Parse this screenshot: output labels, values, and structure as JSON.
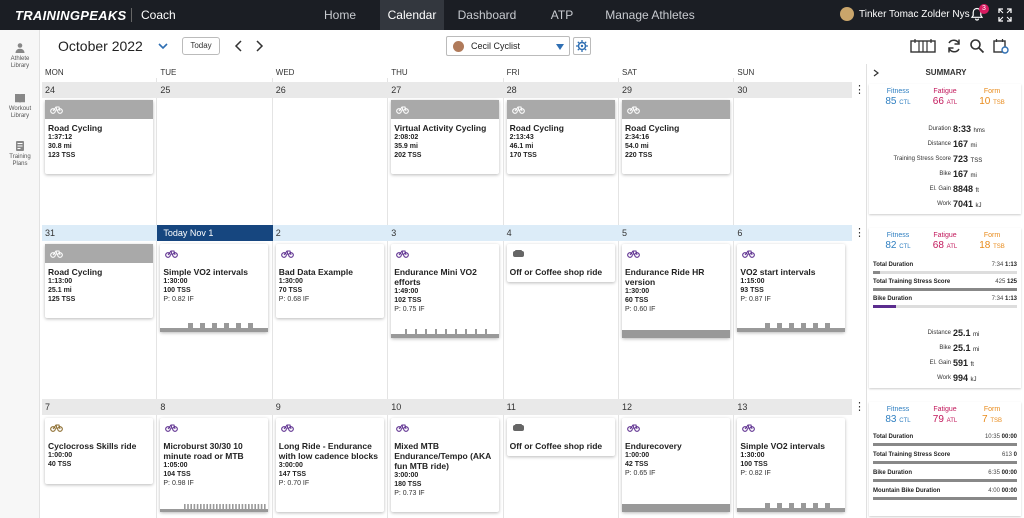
{
  "topbar": {
    "logo": "TRAININGPEAKS",
    "role": "Coach",
    "nav": [
      "Home",
      "Calendar",
      "Dashboard",
      "ATP",
      "Manage Athletes"
    ],
    "active_nav": "Calendar",
    "notification_count": "3",
    "user_name": "Tinker Tomac Zolder Nys"
  },
  "sidebar": [
    {
      "label1": "Athlete",
      "label2": "Library"
    },
    {
      "label1": "Workout",
      "label2": "Library"
    },
    {
      "label1": "Training",
      "label2": "Plans"
    }
  ],
  "toolbar": {
    "month": "October 2022",
    "today_label": "Today",
    "athlete": "Cecil Cyclist"
  },
  "days": [
    "MON",
    "TUE",
    "WED",
    "THU",
    "FRI",
    "SAT",
    "SUN"
  ],
  "weeks": [
    {
      "dates": [
        "24",
        "25",
        "26",
        "27",
        "28",
        "29",
        "30"
      ],
      "today_index": -1,
      "cards": [
        {
          "col": 0,
          "type": "bike-gray",
          "title": "Road Cycling",
          "lines": [
            "1:37:12",
            "30.8 mi",
            "123 TSS"
          ]
        },
        {
          "col": 3,
          "type": "bike-gray",
          "title": "Virtual Activity Cycling",
          "lines": [
            "2:08:02",
            "35.9 mi",
            "202 TSS"
          ]
        },
        {
          "col": 4,
          "type": "bike-gray",
          "title": "Road Cycling",
          "lines": [
            "2:13:43",
            "46.1 mi",
            "170 TSS"
          ]
        },
        {
          "col": 5,
          "type": "bike-gray",
          "title": "Road Cycling",
          "lines": [
            "2:34:16",
            "54.0 mi",
            "220 TSS"
          ]
        }
      ]
    },
    {
      "dates": [
        "31",
        "Today Nov 1",
        "2",
        "3",
        "4",
        "5",
        "6"
      ],
      "today_index": 1,
      "cards": [
        {
          "col": 0,
          "type": "bike-gray",
          "title": "Road Cycling",
          "lines": [
            "1:13:00",
            "25.1 mi",
            "125 TSS"
          ]
        },
        {
          "col": 1,
          "type": "bike",
          "title": "Simple VO2 intervals",
          "lines": [
            "1:30:00",
            "100 TSS"
          ],
          "if": "P: 0.82 IF",
          "spark": "intervals"
        },
        {
          "col": 2,
          "type": "bike",
          "title": "Bad Data Example",
          "lines": [
            "1:30:00",
            "70 TSS"
          ],
          "if": "P: 0.68 IF"
        },
        {
          "col": 3,
          "type": "bike",
          "title": "Endurance Mini VO2 efforts",
          "lines": [
            "1:49:00",
            "102 TSS"
          ],
          "if": "P: 0.75 IF",
          "spark": "spikes"
        },
        {
          "col": 4,
          "type": "other",
          "title": "Off or Coffee shop ride",
          "lines": []
        },
        {
          "col": 5,
          "type": "bike",
          "title": "Endurance Ride HR version",
          "lines": [
            "1:30:00",
            "60 TSS"
          ],
          "if": "P: 0.60 IF",
          "spark": "flat"
        },
        {
          "col": 6,
          "type": "bike",
          "title": "VO2 start intervals",
          "lines": [
            "1:15:00",
            "93 TSS"
          ],
          "if": "P: 0.87 IF",
          "spark": "intervals"
        }
      ]
    },
    {
      "dates": [
        "7",
        "8",
        "9",
        "10",
        "11",
        "12",
        "13"
      ],
      "today_index": -1,
      "cards": [
        {
          "col": 0,
          "type": "mtb",
          "title": "Cyclocross Skills ride",
          "lines": [
            "1:00:00",
            "40 TSS"
          ]
        },
        {
          "col": 1,
          "type": "bike",
          "title": "Microburst 30/30 10 minute road or MTB",
          "lines": [
            "1:05:00",
            "104 TSS"
          ],
          "if": "P: 0.98 IF",
          "spark": "dense"
        },
        {
          "col": 2,
          "type": "bike",
          "title": "Long Ride - Endurance with low cadence blocks",
          "lines": [
            "3:00:00",
            "147 TSS"
          ],
          "if": "P: 0.70 IF"
        },
        {
          "col": 3,
          "type": "bike",
          "title": "Mixed MTB Endurance/Tempo (AKA fun MTB ride)",
          "lines": [
            "3:00:00",
            "180 TSS"
          ],
          "if": "P: 0.73 IF"
        },
        {
          "col": 4,
          "type": "other",
          "title": "Off or Coffee shop ride",
          "lines": []
        },
        {
          "col": 5,
          "type": "bike",
          "title": "Endurecovery",
          "lines": [
            "1:00:00",
            "42 TSS"
          ],
          "if": "P: 0.65 IF",
          "spark": "flat"
        },
        {
          "col": 6,
          "type": "bike",
          "title": "Simple VO2 intervals",
          "lines": [
            "1:30:00",
            "100 TSS"
          ],
          "if": "P: 0.82 IF",
          "spark": "intervals"
        }
      ]
    }
  ],
  "summary": {
    "title": "SUMMARY",
    "week1": {
      "fitness": {
        "label": "Fitness",
        "value": "85",
        "unit": "CTL"
      },
      "fatigue": {
        "label": "Fatigue",
        "value": "66",
        "unit": "ATL"
      },
      "form": {
        "label": "Form",
        "value": "10",
        "unit": "TSB"
      },
      "stats": [
        {
          "label": "Duration",
          "value": "8:33",
          "unit": "hms"
        },
        {
          "label": "Distance",
          "value": "167",
          "unit": "mi"
        },
        {
          "label": "Training Stress Score",
          "value": "723",
          "unit": "TSS"
        },
        {
          "label": "Bike",
          "value": "167",
          "unit": "mi"
        },
        {
          "label": "El. Gain",
          "value": "8848",
          "unit": "ft"
        },
        {
          "label": "Work",
          "value": "7041",
          "unit": "kJ"
        }
      ]
    },
    "week2": {
      "fitness": {
        "label": "Fitness",
        "value": "82",
        "unit": "CTL"
      },
      "fatigue": {
        "label": "Fatigue",
        "value": "68",
        "unit": "ATL"
      },
      "form": {
        "label": "Form",
        "value": "18",
        "unit": "TSB"
      },
      "progress": [
        {
          "label": "Total Duration",
          "done": "7:34",
          "plan": "1:13",
          "pct": 0.05,
          "color": "#888"
        },
        {
          "label": "Total Training Stress Score",
          "done": "425",
          "plan": "125",
          "pct": 1.0,
          "color": "#888"
        },
        {
          "label": "Bike Duration",
          "done": "7:34",
          "plan": "1:13",
          "pct": 0.16,
          "color": "#5b2d8e"
        }
      ],
      "stats": [
        {
          "label": "Distance",
          "value": "25.1",
          "unit": "mi"
        },
        {
          "label": "Bike",
          "value": "25.1",
          "unit": "mi"
        },
        {
          "label": "El. Gain",
          "value": "591",
          "unit": "ft"
        },
        {
          "label": "Work",
          "value": "994",
          "unit": "kJ"
        }
      ]
    },
    "week3": {
      "fitness": {
        "label": "Fitness",
        "value": "83",
        "unit": "CTL"
      },
      "fatigue": {
        "label": "Fatigue",
        "value": "79",
        "unit": "ATL"
      },
      "form": {
        "label": "Form",
        "value": "7",
        "unit": "TSB"
      },
      "progress": [
        {
          "label": "Total Duration",
          "done": "10:35",
          "plan": "00:00",
          "pct": 1.0,
          "color": "#888"
        },
        {
          "label": "Total Training Stress Score",
          "done": "613",
          "plan": "0",
          "pct": 1.0,
          "color": "#888"
        },
        {
          "label": "Bike Duration",
          "done": "6:35",
          "plan": "00:00",
          "pct": 1.0,
          "color": "#888"
        },
        {
          "label": "Mountain Bike Duration",
          "done": "4:00",
          "plan": "00:00",
          "pct": 1.0,
          "color": "#888"
        }
      ]
    }
  },
  "colors": {
    "fitness": "#2f7fc1",
    "fatigue": "#c2185b",
    "form": "#e88a1a",
    "today": "#16467f",
    "bike": "#5b2d8e"
  }
}
